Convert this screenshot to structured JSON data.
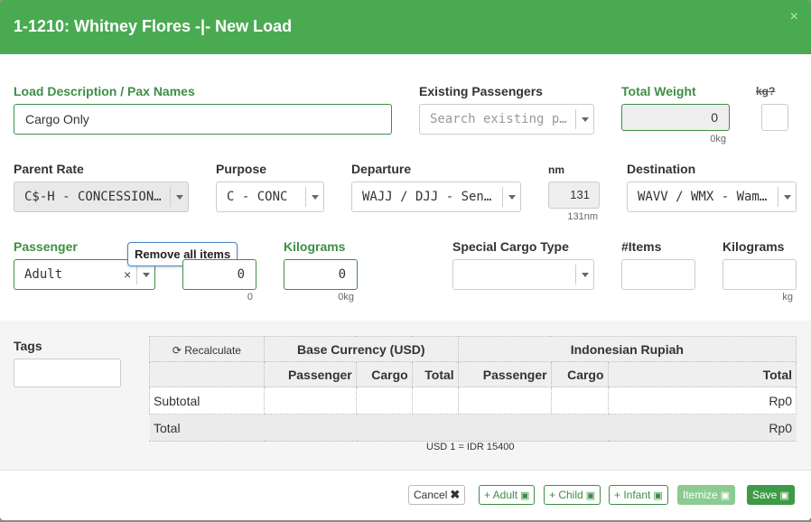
{
  "title": "1-1210: Whitney Flores -|- New Load",
  "close_glyph": "×",
  "load_description": {
    "label": "Load Description / Pax Names",
    "value": "Cargo Only"
  },
  "existing_passengers": {
    "label": "Existing Passengers",
    "placeholder": "Search existing pa…"
  },
  "total_weight": {
    "label": "Total Weight",
    "value": "0",
    "hint": "0kg"
  },
  "kg_unknown": {
    "label": "kg?"
  },
  "parent_rate": {
    "label": "Parent Rate",
    "value": "C$-H - CONCESSION …"
  },
  "purpose": {
    "label": "Purpose",
    "value": "C - CONC"
  },
  "departure": {
    "label": "Departure",
    "value": "WAJJ / DJJ - Sent…"
  },
  "distance": {
    "label": "nm",
    "value": "131",
    "hint": "131nm"
  },
  "destination": {
    "label": "Destination",
    "value": "WAVV / WMX - Wame…"
  },
  "passenger": {
    "label": "Passenger",
    "value": "Adult",
    "clear_glyph": "×"
  },
  "tooltip": "Remove all items",
  "pax_count": {
    "value": "0",
    "hint": "0"
  },
  "kilograms": {
    "label": "Kilograms",
    "value": "0",
    "hint": "0kg"
  },
  "special_cargo": {
    "label": "Special Cargo Type"
  },
  "items": {
    "label": "#Items"
  },
  "cargo_kilograms": {
    "label": "Kilograms",
    "hint": "kg"
  },
  "tags": {
    "label": "Tags"
  },
  "calc": {
    "recalculate": "Recalculate",
    "base_currency": "Base Currency (USD)",
    "local_currency": "Indonesian Rupiah",
    "columns": [
      "Passenger",
      "Cargo",
      "Total",
      "Passenger",
      "Cargo",
      "Total"
    ],
    "subtotal_label": "Subtotal",
    "subtotal_value": "Rp0",
    "total_label": "Total",
    "total_value": "Rp0",
    "rate": "USD 1 = IDR 15400"
  },
  "buttons": {
    "cancel": "Cancel",
    "adult": "+ Adult",
    "child": "+ Child",
    "infant": "+ Infant",
    "itemize": "Itemize",
    "save": "Save"
  },
  "colors": {
    "header": "#4aaa52",
    "accent": "#3e8e45",
    "tooltip_border": "#4a86c5"
  }
}
